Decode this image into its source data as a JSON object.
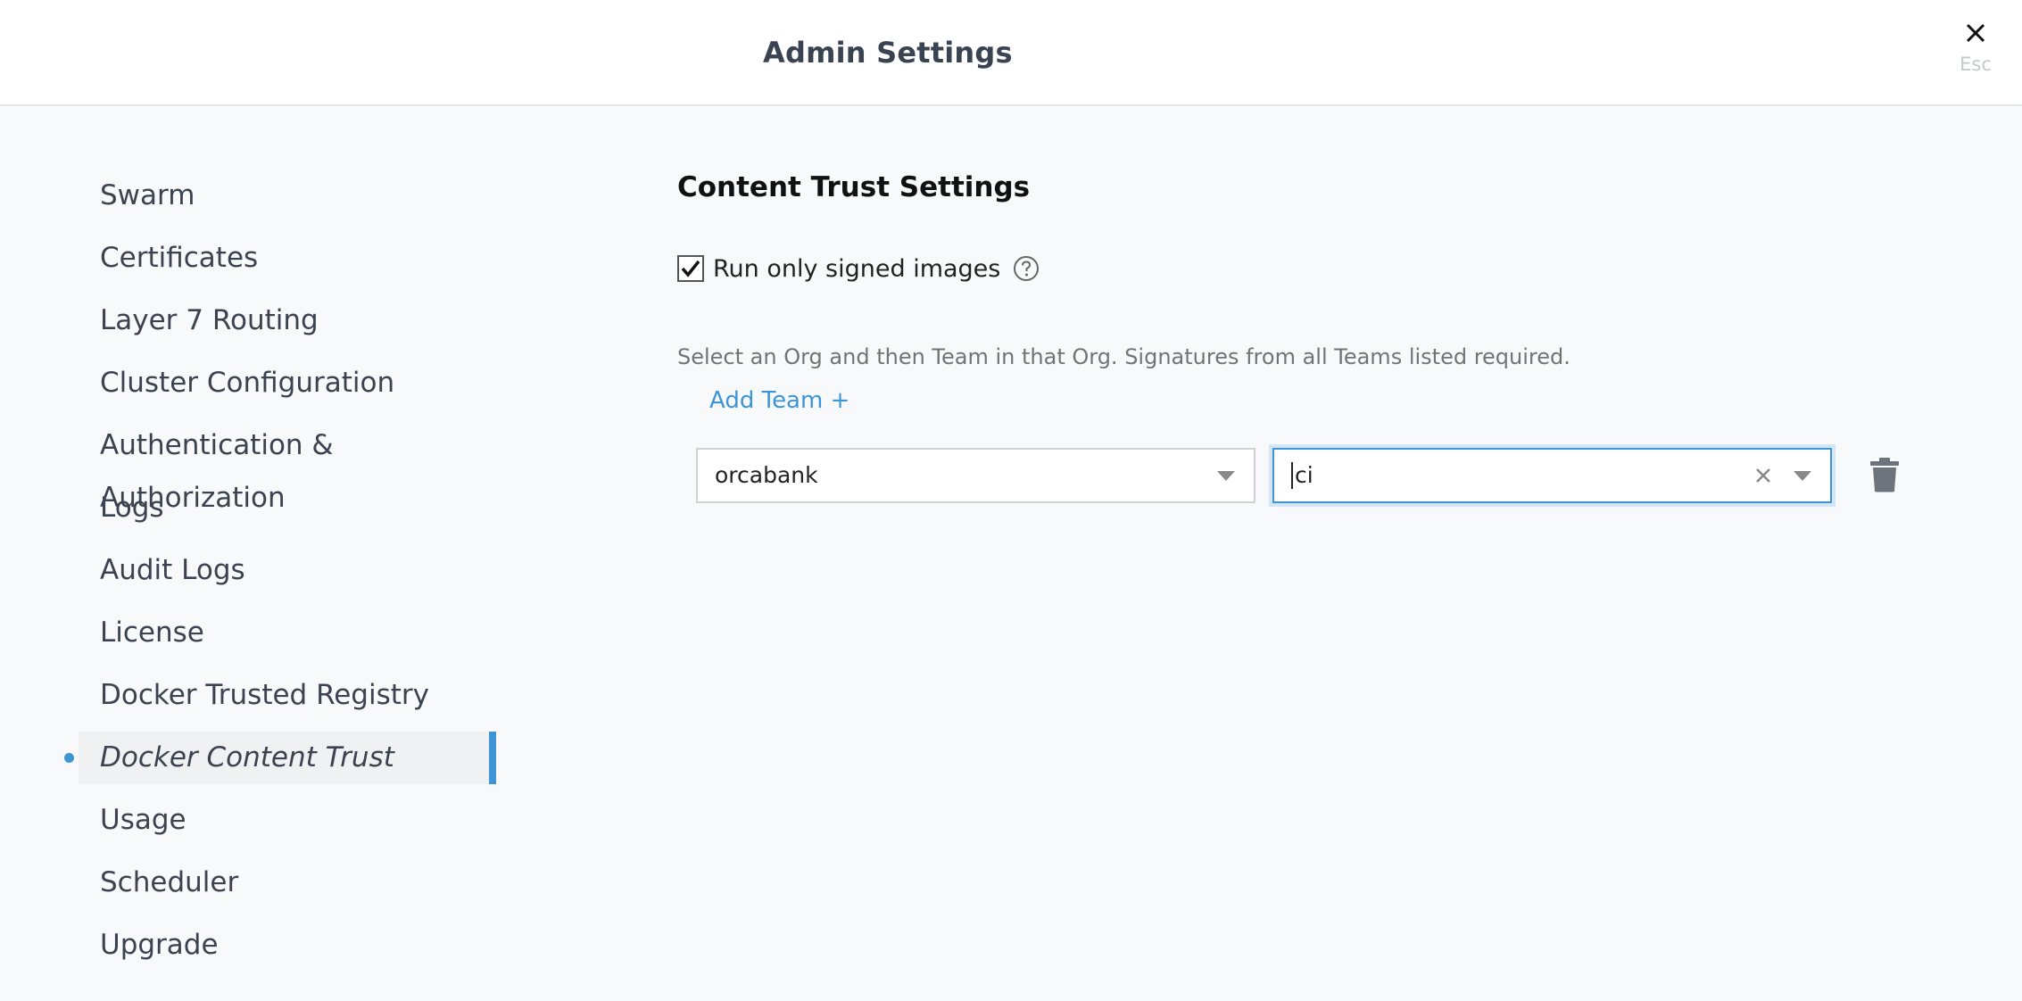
{
  "header": {
    "title": "Admin Settings",
    "close_hint": "Esc"
  },
  "sidebar": {
    "items": [
      {
        "label": "Swarm"
      },
      {
        "label": "Certificates"
      },
      {
        "label": "Layer 7 Routing"
      },
      {
        "label": "Cluster Configuration"
      },
      {
        "label": "Authentication & Authorization"
      },
      {
        "label": "Logs"
      },
      {
        "label": "Audit Logs"
      },
      {
        "label": "License"
      },
      {
        "label": "Docker Trusted Registry"
      },
      {
        "label": "Docker Content Trust",
        "active": true
      },
      {
        "label": "Usage"
      },
      {
        "label": "Scheduler"
      },
      {
        "label": "Upgrade"
      }
    ]
  },
  "main": {
    "title": "Content Trust Settings",
    "checkbox_label": "Run only signed images",
    "checkbox_checked": true,
    "description": "Select an Org and then Team in that Org. Signatures from all Teams listed required.",
    "add_team_label": "Add Team +",
    "org_select_value": "orcabank",
    "team_input_value": "ci"
  },
  "colors": {
    "accent": "#3d95d6",
    "background": "#f8f9fa"
  },
  "icons": {
    "close": "close-icon",
    "help": "question-circle-icon",
    "clear": "clear-x-icon",
    "dropdown": "chevron-down-icon",
    "delete": "trash-icon",
    "check": "checkmark-icon"
  }
}
